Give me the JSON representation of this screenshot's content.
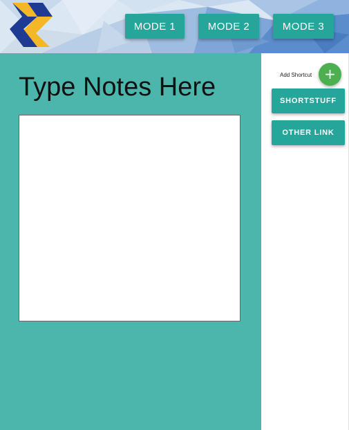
{
  "header": {
    "modes": [
      {
        "label": "MODE 1"
      },
      {
        "label": "MODE 2"
      },
      {
        "label": "MODE 3"
      }
    ]
  },
  "main": {
    "title": "Type Notes Here",
    "notes_value": ""
  },
  "sidebar": {
    "add_label": "Add Shortcut",
    "add_icon": "+",
    "shortcuts": [
      {
        "label": "SHORTSTUFF"
      },
      {
        "label": "OTHER LINK"
      }
    ]
  },
  "colors": {
    "accent": "#26a69a",
    "main_bg": "#4db6ac",
    "fab": "#4caf50",
    "logo_blue": "#1f3a93",
    "logo_yellow": "#f5b727"
  }
}
